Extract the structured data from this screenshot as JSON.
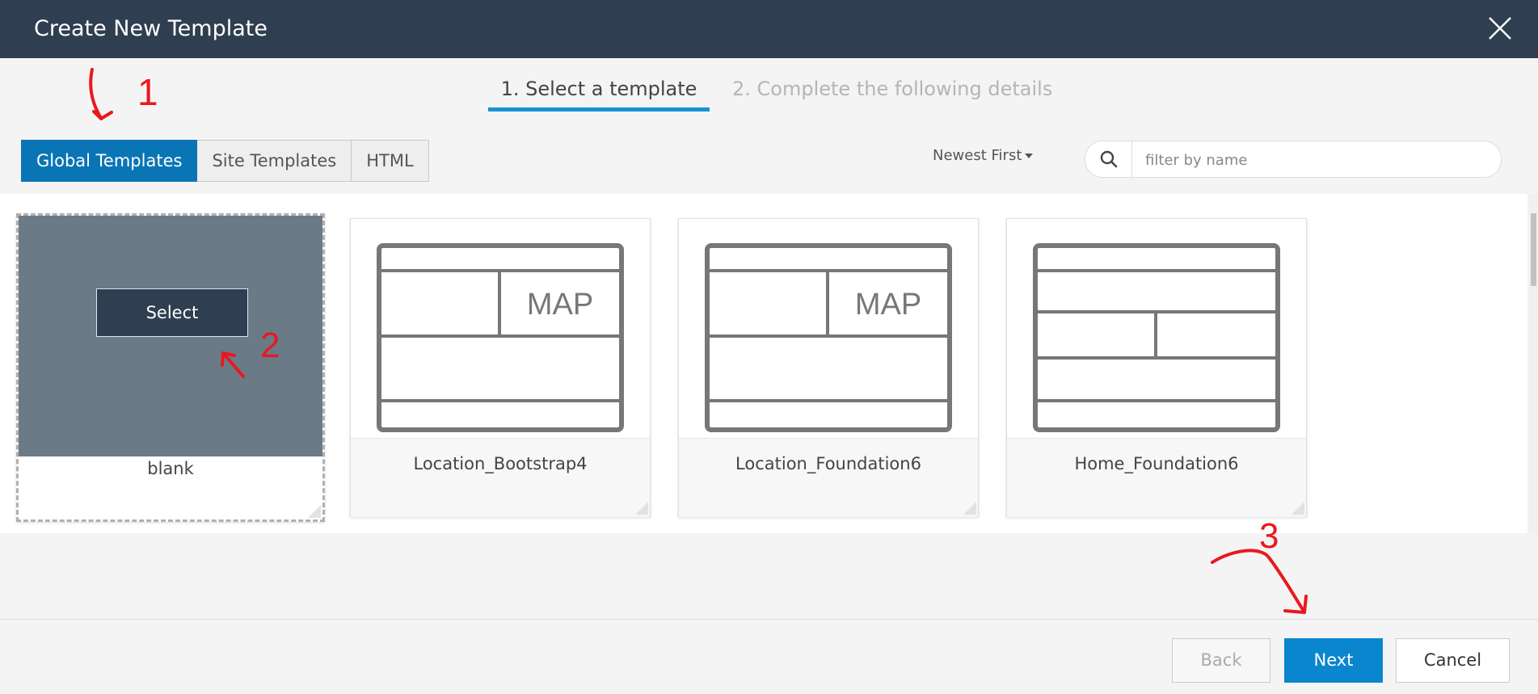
{
  "dialog": {
    "title": "Create New Template"
  },
  "steps": [
    {
      "label": "1. Select a template"
    },
    {
      "label": "2. Complete the following details"
    }
  ],
  "tabs": [
    {
      "label": "Global Templates",
      "active": true
    },
    {
      "label": "Site Templates",
      "active": false
    },
    {
      "label": "HTML",
      "active": false
    }
  ],
  "sort": {
    "label": "Newest First"
  },
  "search": {
    "placeholder": "filter by name",
    "value": ""
  },
  "templates": [
    {
      "name": "blank",
      "selected": true,
      "select_label": "Select"
    },
    {
      "name": "Location_Bootstrap4",
      "thumb_text": "MAP"
    },
    {
      "name": "Location_Foundation6",
      "thumb_text": "MAP"
    },
    {
      "name": "Home_Foundation6"
    }
  ],
  "footer": {
    "back_label": "Back",
    "next_label": "Next",
    "cancel_label": "Cancel"
  },
  "annotations": [
    "1",
    "2",
    "3"
  ],
  "colors": {
    "header": "#2f3e50",
    "accent": "#0a75b5",
    "next": "#0a86cf",
    "annotation": "#e8191e"
  }
}
